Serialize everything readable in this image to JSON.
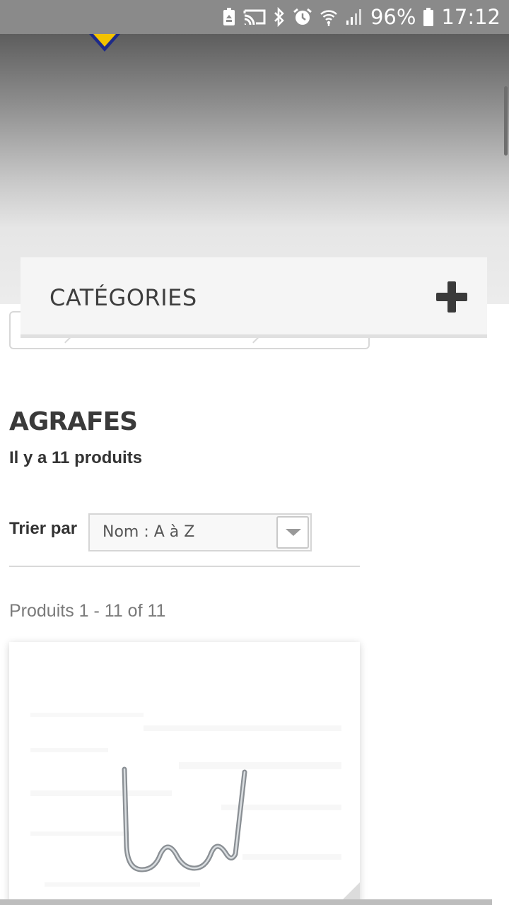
{
  "status_bar": {
    "battery_percent": "96%",
    "time": "17:12",
    "icons": [
      "battery-saver-icon",
      "cast-icon",
      "bluetooth-icon",
      "alarm-icon",
      "wifi-icon",
      "signal-icon",
      "battery-icon"
    ]
  },
  "categories": {
    "title": "CATÉGORIES",
    "toggle_icon": "plus-icon"
  },
  "page": {
    "title": "AGRAFES",
    "product_count": "Il y a 11 produits"
  },
  "sort": {
    "label": "Trier par",
    "selected": "Nom : A à Z"
  },
  "pagination": {
    "info": "Produits 1 - 11 of 11"
  },
  "colors": {
    "header_top": "#5d5d5d",
    "header_bottom": "#ececec",
    "logo_yellow": "#f2c200",
    "logo_blue": "#1d2a8a"
  }
}
